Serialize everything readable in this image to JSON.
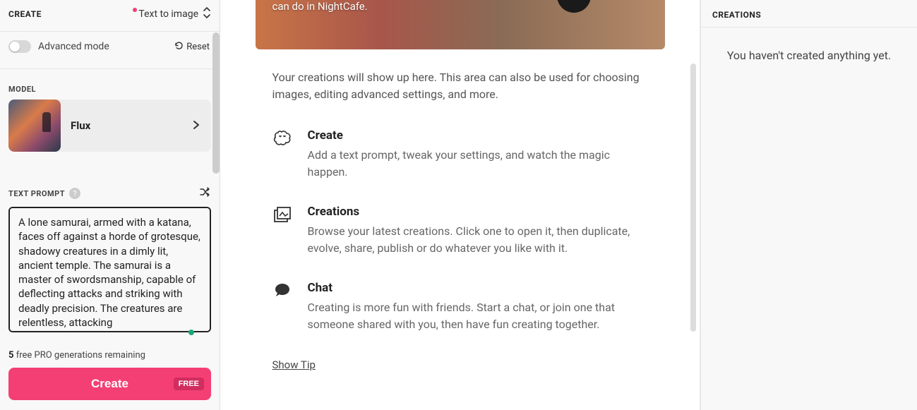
{
  "left": {
    "title": "CREATE",
    "mode": "Text to image",
    "advanced_label": "Advanced mode",
    "reset_label": "Reset",
    "model_section": "MODEL",
    "model_name": "Flux",
    "prompt_section": "TEXT PROMPT",
    "prompt_value": "A lone samurai, armed with a katana, faces off against a horde of grotesque, shadowy creatures in a dimly lit, ancient temple. The samurai is a master of swordsmanship, capable of deflecting attacks and striking with deadly precision. The creatures are relentless, attacking",
    "gen_count": "5",
    "gen_text": " free PRO generations remaining",
    "create_btn": "Create",
    "free_badge": "FREE"
  },
  "middle": {
    "hero_text": "can do in NightCafe.",
    "intro": "Your creations will show up here. This area can also be used for choosing images, editing advanced settings, and more.",
    "features": [
      {
        "title": "Create",
        "desc": "Add a text prompt, tweak your settings, and watch the magic happen."
      },
      {
        "title": "Creations",
        "desc": "Browse your latest creations. Click one to open it, then duplicate, evolve, share, publish or do whatever you like with it."
      },
      {
        "title": "Chat",
        "desc": "Creating is more fun with friends. Start a chat, or join one that someone shared with you, then have fun creating together."
      }
    ],
    "show_tip": "Show Tip"
  },
  "right": {
    "title": "CREATIONS",
    "empty": "You haven't created anything yet."
  }
}
